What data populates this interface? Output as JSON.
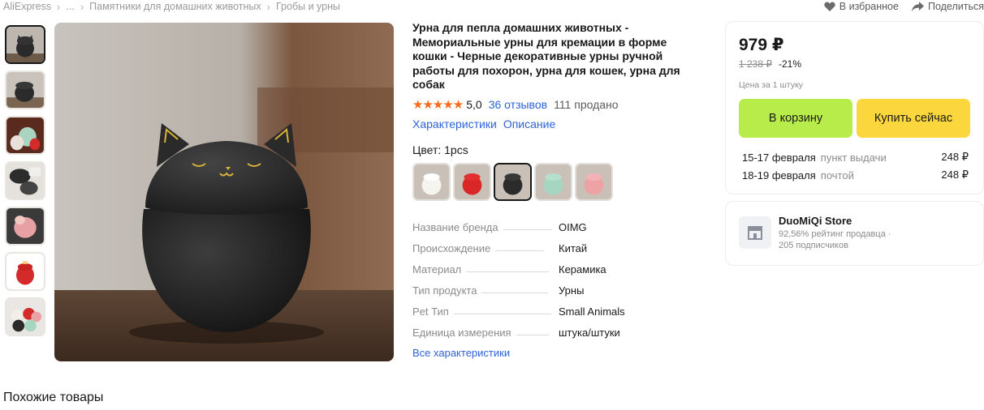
{
  "breadcrumb": {
    "items": [
      "AliExpress",
      "...",
      "Памятники для домашних животных",
      "Гробы и урны"
    ]
  },
  "actions": {
    "favorite": "В избранное",
    "share": "Поделиться"
  },
  "gallery": {
    "thumbnails": [
      {
        "name": "black-cat-urn",
        "color": "#2b2b2b"
      },
      {
        "name": "black-cat-urn-side",
        "color": "#2b2b2b"
      },
      {
        "name": "cat-urns-set",
        "color": "#9fc9b6"
      },
      {
        "name": "urn-in-hand",
        "color": "#c6c6c6"
      },
      {
        "name": "pink-cat-urn-hand",
        "color": "#e9a3a3"
      },
      {
        "name": "red-cat-urn",
        "color": "#d63232"
      },
      {
        "name": "cat-urns-group",
        "color": "#d63232"
      }
    ]
  },
  "product": {
    "title": "Урна для пепла домашних животных - Мемориальные урны для кремации в форме кошки - Черные декоративные урны ручной работы для похорон, урна для кошек, урна для собак",
    "rating": "5,0",
    "reviews": "36 отзывов",
    "sold": "111 продано",
    "tabs": [
      "Характеристики",
      "Описание"
    ],
    "color_label": "Цвет: 1pcs",
    "swatches": [
      {
        "name": "white",
        "color": "#f4f2ee"
      },
      {
        "name": "red",
        "color": "#d92626"
      },
      {
        "name": "black",
        "color": "#2b2b2b"
      },
      {
        "name": "mint",
        "color": "#a6d6c2"
      },
      {
        "name": "pink",
        "color": "#eea2a6"
      }
    ],
    "specs": [
      {
        "key": "Название бренда",
        "value": "OIMG"
      },
      {
        "key": "Происхождение",
        "value": "Китай"
      },
      {
        "key": "Материал",
        "value": "Керамика"
      },
      {
        "key": "Тип продукта",
        "value": "Урны"
      },
      {
        "key": "Pet Тип",
        "value": "Small Animals"
      },
      {
        "key": "Единица измерения",
        "value": "штука/штуки"
      }
    ],
    "all_specs": "Все характеристики"
  },
  "buy": {
    "price": "979 ₽",
    "old_price": "1 238 ₽",
    "discount": "-21%",
    "per_unit": "Цена за 1 штуку",
    "cart_button": "В корзину",
    "buy_button": "Купить сейчас",
    "shipping": [
      {
        "date": "15-17 февраля",
        "method": "пункт выдачи",
        "cost": "248 ₽"
      },
      {
        "date": "18-19 февраля",
        "method": "почтой",
        "cost": "248 ₽"
      }
    ]
  },
  "store": {
    "name": "DuoMiQi Store",
    "rating": "92,56% рейтинг продавца ·",
    "followers": "205 подписчиков"
  },
  "similar_title": "Похожие товары",
  "colors": {
    "accent_link": "#2e63d6",
    "star": "#ff6a1a",
    "cart_button": "#b8ec4a",
    "buy_button": "#fbd63c"
  }
}
